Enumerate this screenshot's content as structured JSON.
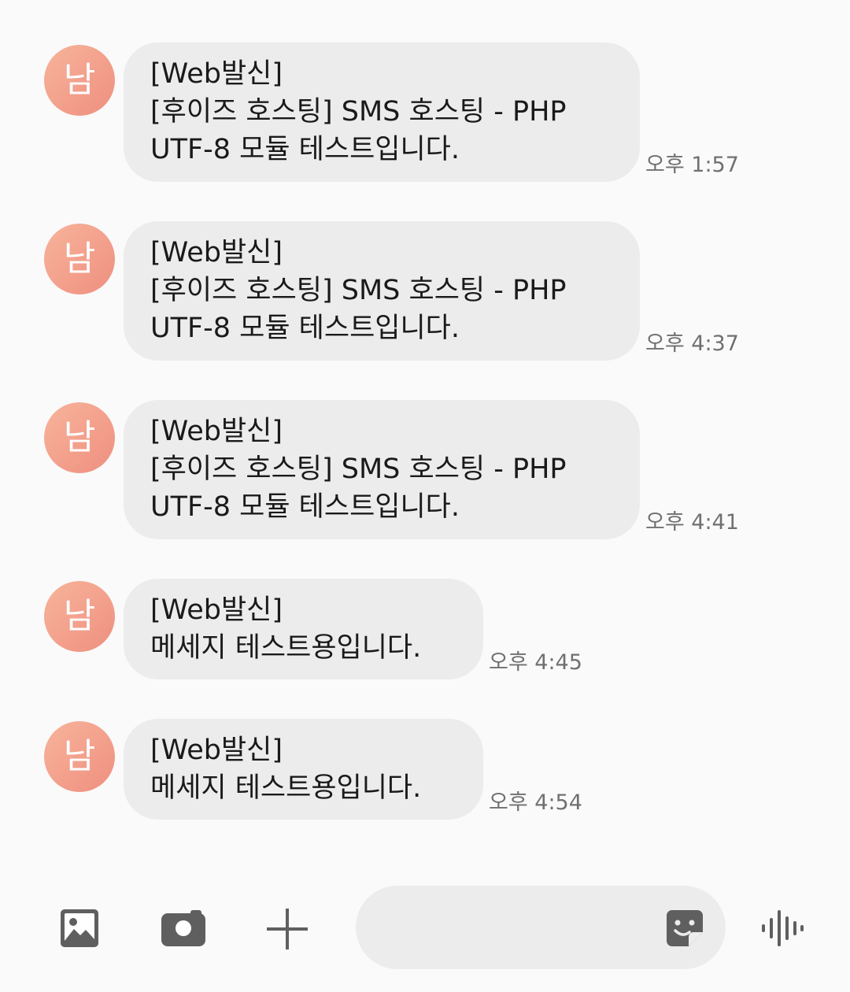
{
  "messages": [
    {
      "avatar_label": "남",
      "lines": [
        "[Web발신]",
        "[후이즈 호스팅] SMS 호스팅 - PHP",
        "UTF-8 모듈 테스트입니다."
      ],
      "time": "오후 1:57"
    },
    {
      "avatar_label": "남",
      "lines": [
        "[Web발신]",
        "[후이즈 호스팅] SMS 호스팅 - PHP",
        "UTF-8 모듈 테스트입니다."
      ],
      "time": "오후 4:37"
    },
    {
      "avatar_label": "남",
      "lines": [
        "[Web발신]",
        "[후이즈 호스팅] SMS 호스팅 - PHP",
        "UTF-8 모듈 테스트입니다."
      ],
      "time": "오후 4:41"
    },
    {
      "avatar_label": "남",
      "lines": [
        "[Web발신]",
        "메세지 테스트용입니다."
      ],
      "time": "오후 4:45"
    },
    {
      "avatar_label": "남",
      "lines": [
        "[Web발신]",
        "메세지 테스트용입니다."
      ],
      "time": "오후 4:54"
    }
  ],
  "composer": {
    "input_value": "",
    "icons": [
      "image-icon",
      "camera-icon",
      "plus-icon",
      "sticker-icon",
      "voice-icon"
    ]
  },
  "colors": {
    "background": "#fafafa",
    "bubble": "#ececec",
    "avatar_gradient_start": "#f7b49b",
    "avatar_gradient_end": "#ef8f80",
    "icon": "#5f5f5f",
    "timestamp": "#707070"
  }
}
